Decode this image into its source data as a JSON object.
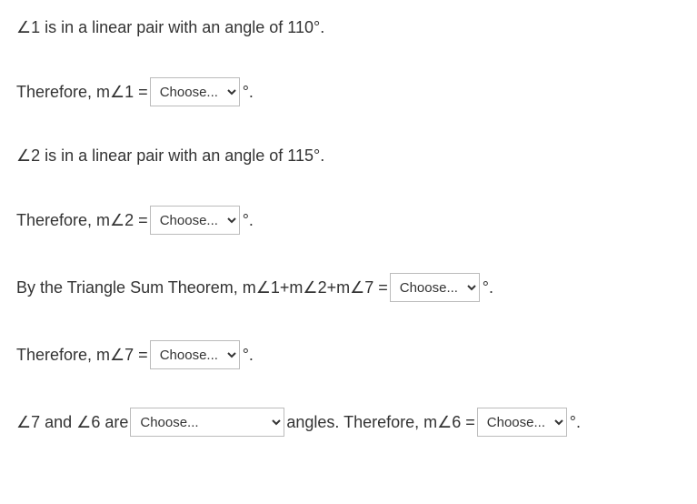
{
  "lines": {
    "l1": {
      "pre": "∠1 is in a linear pair with an angle of 110°."
    },
    "l2": {
      "pre": "Therefore, m∠1 = ",
      "deg": "°."
    },
    "l3": {
      "pre": "∠2 is in a linear pair with an angle of 115°."
    },
    "l4": {
      "pre": "Therefore, m∠2 = ",
      "deg": "°."
    },
    "l5": {
      "pre": "By the Triangle Sum Theorem, m∠1+m∠2+m∠7 = ",
      "deg": "°."
    },
    "l6": {
      "pre": "Therefore, m∠7 = ",
      "deg": "°."
    },
    "l7": {
      "pre": "∠7 and ∠6 are ",
      "mid": " angles. Therefore, m∠6 = ",
      "deg": "°."
    }
  },
  "select": {
    "placeholder": "Choose..."
  }
}
